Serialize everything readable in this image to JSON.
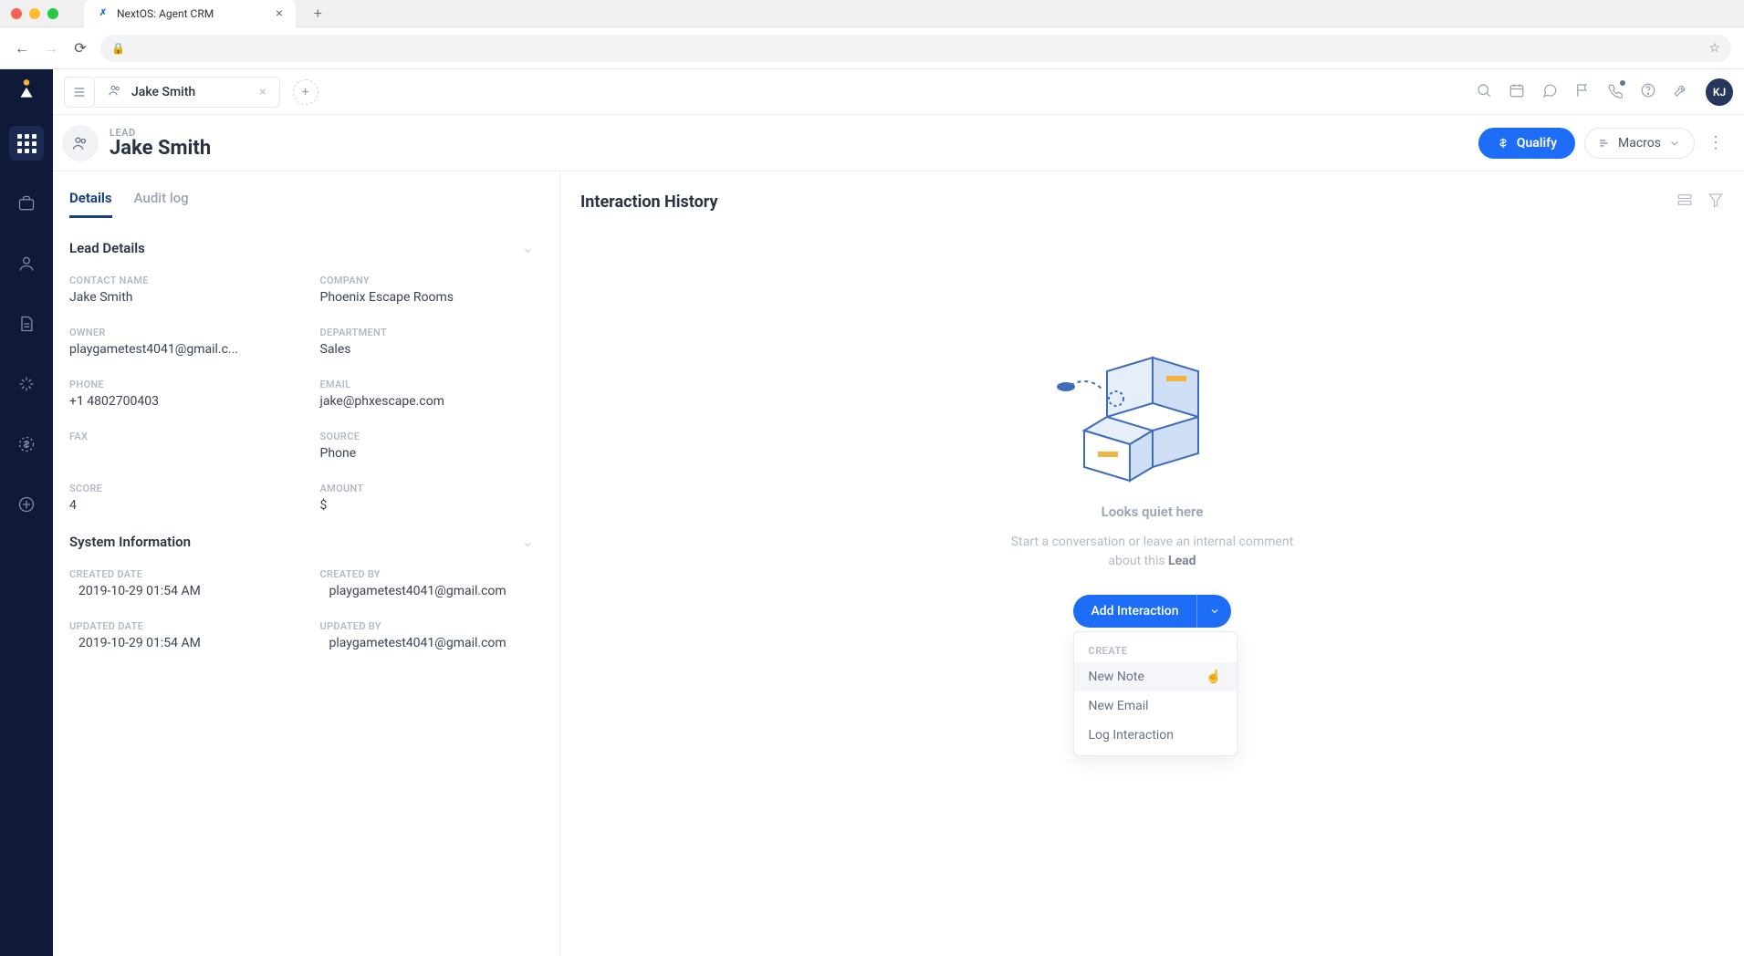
{
  "browser": {
    "tab_title": "NextOS: Agent CRM"
  },
  "app_tab": {
    "title": "Jake Smith"
  },
  "topbar": {
    "avatar_initials": "KJ"
  },
  "record": {
    "type_label": "LEAD",
    "name": "Jake Smith",
    "qualify_label": "Qualify",
    "macros_label": "Macros"
  },
  "tabs": {
    "details": "Details",
    "audit": "Audit log"
  },
  "lead_details": {
    "section_title": "Lead Details",
    "contact_name": {
      "label": "CONTACT NAME",
      "value": "Jake Smith"
    },
    "company": {
      "label": "COMPANY",
      "value": "Phoenix Escape Rooms"
    },
    "owner": {
      "label": "OWNER",
      "value": "playgametest4041@gmail.c..."
    },
    "department": {
      "label": "DEPARTMENT",
      "value": "Sales"
    },
    "phone": {
      "label": "PHONE",
      "value": "+1 4802700403"
    },
    "email": {
      "label": "EMAIL",
      "value": "jake@phxescape.com"
    },
    "fax": {
      "label": "FAX",
      "value": ""
    },
    "source": {
      "label": "SOURCE",
      "value": "Phone"
    },
    "score": {
      "label": "SCORE",
      "value": "4"
    },
    "amount": {
      "label": "AMOUNT",
      "value": "$"
    }
  },
  "system_info": {
    "section_title": "System Information",
    "created_date": {
      "label": "CREATED DATE",
      "value": "2019-10-29 01:54 AM"
    },
    "created_by": {
      "label": "CREATED BY",
      "value": "playgametest4041@gmail.com"
    },
    "updated_date": {
      "label": "UPDATED DATE",
      "value": "2019-10-29 01:54 AM"
    },
    "updated_by": {
      "label": "UPDATED BY",
      "value": "playgametest4041@gmail.com"
    }
  },
  "interaction": {
    "title": "Interaction History",
    "empty_title": "Looks quiet here",
    "empty_sub_pre": "Start a conversation or leave an internal comment about this ",
    "empty_sub_strong": "Lead",
    "add_button": "Add Interaction",
    "menu_section": "CREATE",
    "menu_items": {
      "new_note": "New Note",
      "new_email": "New Email",
      "log_interaction": "Log Interaction"
    }
  }
}
